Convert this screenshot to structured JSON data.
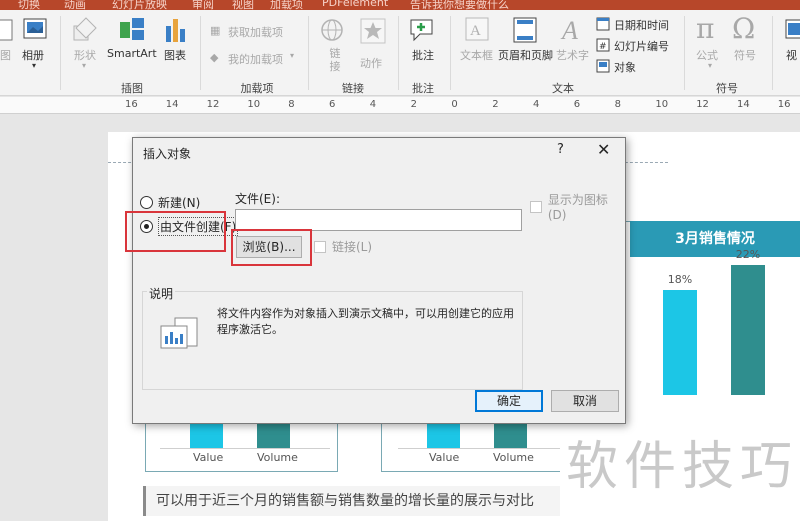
{
  "ribbon": {
    "tabs": [
      "切换",
      "动画",
      "幻灯片放映",
      "审阅",
      "视图",
      "加载项",
      "PDFelement",
      "告诉我你想要做什么"
    ],
    "buttons": {
      "pictures_partial": "图",
      "album": "相册",
      "shapes": "形状",
      "smartart": "SmartArt",
      "chart": "图表",
      "get_addins": "获取加载项",
      "my_addins": "我的加载项",
      "link": "链接",
      "action": "动作",
      "comment": "批注",
      "textbox": "文本框",
      "header_footer": "页眉和页脚",
      "wordart": "艺术字",
      "date_time": "日期和时间",
      "slide_number": "幻灯片编号",
      "object": "对象",
      "equation": "公式",
      "symbol": "符号",
      "video_partial": "视"
    },
    "groups": {
      "illustrations": "插图",
      "addins": "加载项",
      "links": "链接",
      "comments": "批注",
      "text": "文本",
      "symbols": "符号"
    }
  },
  "ruler": {
    "numbers": [
      "16",
      "14",
      "12",
      "10",
      "8",
      "6",
      "4",
      "2",
      "0",
      "2",
      "4",
      "6",
      "8",
      "10",
      "12",
      "14",
      "16"
    ]
  },
  "slide": {
    "banner_title": "3月销售情况",
    "footnote": "可以用于近三个月的销售额与销售数量的增长量的展示与对比",
    "bar_labels": [
      "18%",
      "22%"
    ],
    "axis_labels": [
      "Value",
      "Volume",
      "Value",
      "Volume"
    ],
    "colors": {
      "value_bar": "#1cc6e6",
      "volume_bar": "#2f8e8e",
      "banner": "#2a9ab5"
    }
  },
  "chart_data": {
    "type": "bar",
    "title": "3月销售情况",
    "categories": [
      "Value",
      "Volume"
    ],
    "values": [
      18,
      22
    ],
    "ylabel": "",
    "xlabel": ""
  },
  "dialog": {
    "title": "插入对象",
    "help": "?",
    "close": "✕",
    "radio_new": "新建(N)",
    "radio_from_file": "由文件创建(F)",
    "file_label": "文件(E):",
    "file_value": "",
    "browse": "浏览(B)...",
    "link": "链接(L)",
    "display_as_icon": "显示为图标(D)",
    "description_title": "说明",
    "description_text": "将文件内容作为对象插入到演示文稿中，可以用创建它的应用程序激活它。",
    "ok": "确定",
    "cancel": "取消"
  },
  "watermark": "软件技巧"
}
